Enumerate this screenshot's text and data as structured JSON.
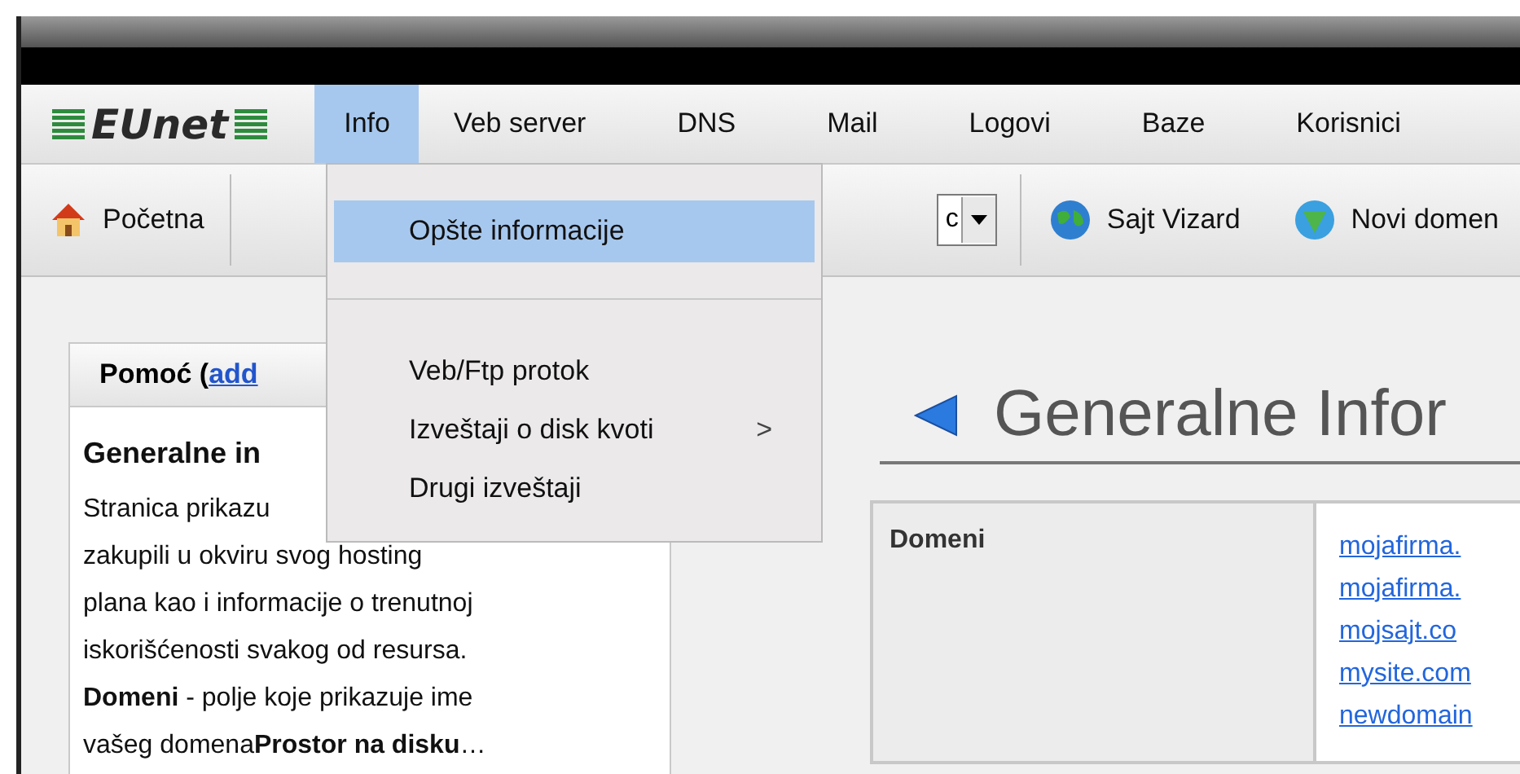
{
  "logo": "EUnet",
  "menu_bar": [
    {
      "label": "Info",
      "selected": true
    },
    {
      "label": "Veb server",
      "selected": false
    },
    {
      "label": "DNS",
      "selected": false
    },
    {
      "label": "Mail",
      "selected": false
    },
    {
      "label": "Logovi",
      "selected": false
    },
    {
      "label": "Baze",
      "selected": false
    },
    {
      "label": "Korisnici",
      "selected": false
    }
  ],
  "toolbar": {
    "home": "Početna",
    "select_value": "c",
    "wizard": "Sajt Vizard",
    "new_domain": "Novi domen"
  },
  "dropdown": [
    {
      "kind": "item",
      "label": "Opšte informacije",
      "selected": true
    },
    {
      "kind": "separator"
    },
    {
      "kind": "item",
      "label": "Veb/Ftp protok",
      "selected": false
    },
    {
      "kind": "item",
      "label": "Izveštaji o disk kvoti",
      "selected": false,
      "submenu_mark": ">"
    },
    {
      "kind": "item",
      "label": "Drugi izveštaji",
      "selected": false
    }
  ],
  "help": {
    "header": "Pomoć (",
    "header_link": "add",
    "title": "Generalne in",
    "lines": [
      "Stranica prikazu",
      "zakupili u okviru svog hosting",
      "plana kao i informacije o trenutnoj",
      "iskorišćenosti svakog od resursa.",
      "**Domeni** - polje koje prikazuje ime",
      "vašeg domena**Prostor na disku**…"
    ]
  },
  "page_title": "Generalne Infor",
  "table": {
    "rows": [
      {
        "label": "Domeni",
        "links": [
          "mojafirma.",
          "mojafirma.",
          "mojsajt.co",
          "mysite.com",
          "newdomain"
        ]
      }
    ]
  }
}
